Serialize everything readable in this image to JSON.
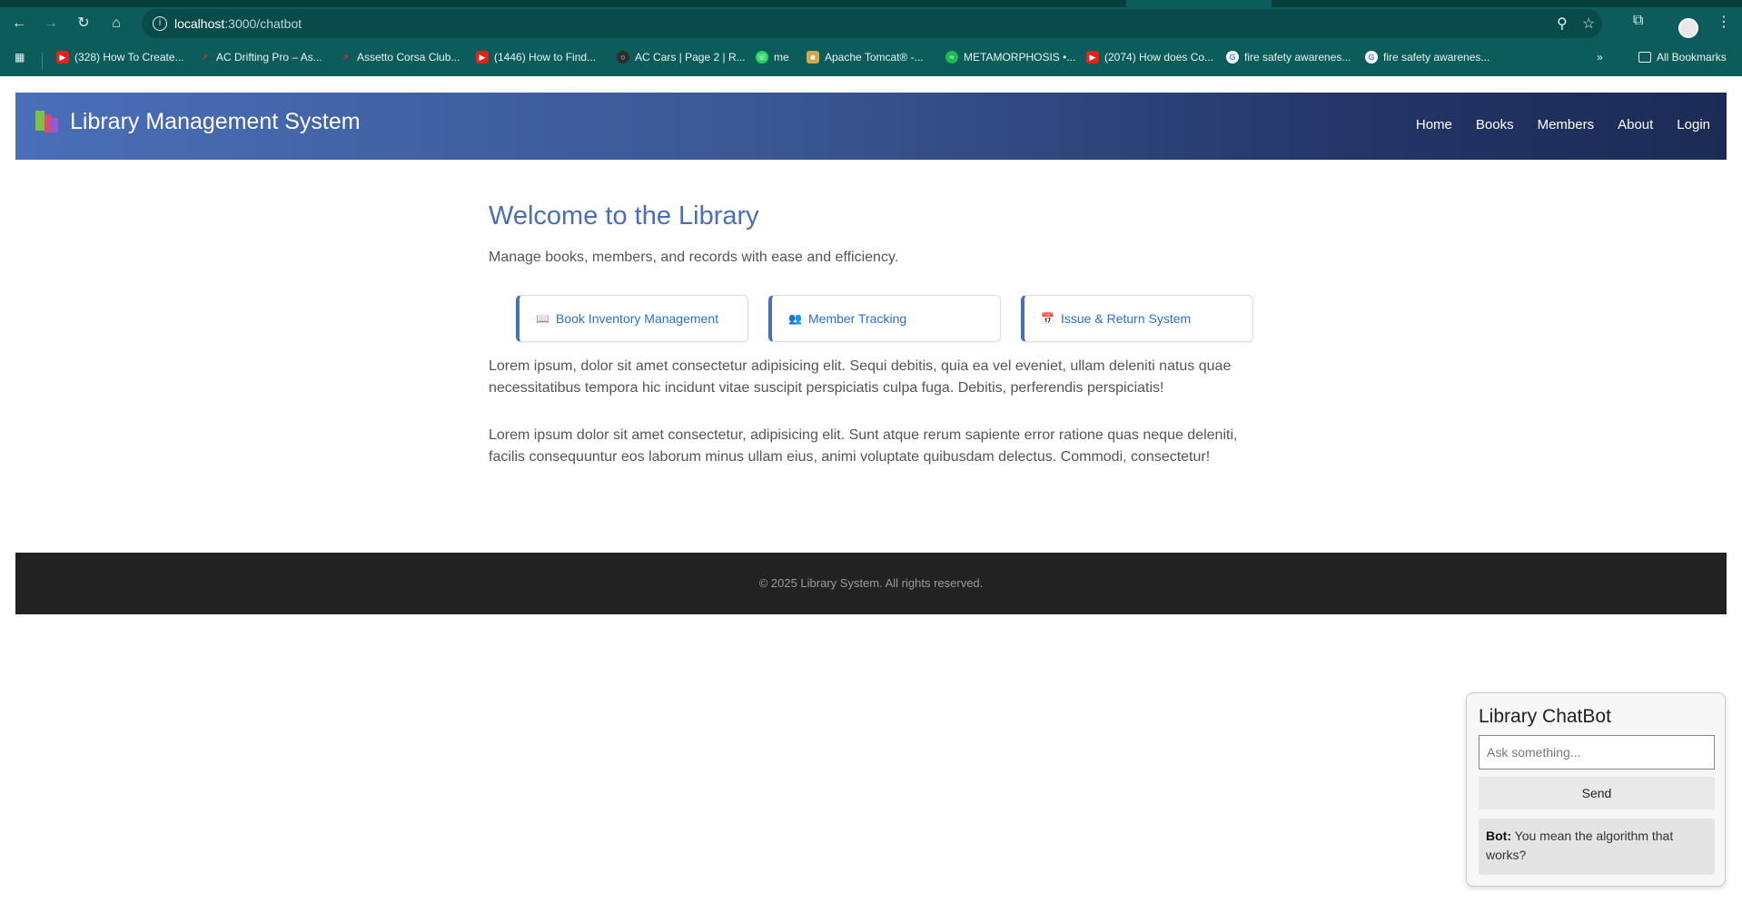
{
  "browser": {
    "url_host": "localhost",
    "url_path": ":3000/chatbot",
    "bookmarks": [
      {
        "icon": "youtube-icon",
        "label": "(328) How To Create..."
      },
      {
        "icon": "ac-drifting-icon",
        "label": "AC Drifting Pro – As..."
      },
      {
        "icon": "assetto-corsa-icon",
        "label": "Assetto Corsa Club..."
      },
      {
        "icon": "youtube-icon",
        "label": "(1446) How to Find..."
      },
      {
        "icon": "race-icon",
        "label": "AC Cars | Page 2 | R..."
      },
      {
        "icon": "whatsapp-icon",
        "label": "me"
      },
      {
        "icon": "tomcat-icon",
        "label": "Apache Tomcat® -..."
      },
      {
        "icon": "spotify-icon",
        "label": "METAMORPHOSIS •..."
      },
      {
        "icon": "youtube-icon",
        "label": "(2074) How does Co..."
      },
      {
        "icon": "google-icon",
        "label": "fire safety awarenes..."
      },
      {
        "icon": "google-icon",
        "label": "fire safety awarenes..."
      }
    ],
    "all_bookmarks": "All Bookmarks"
  },
  "header": {
    "title": "Library Management System",
    "nav": [
      "Home",
      "Books",
      "Members",
      "About",
      "Login"
    ]
  },
  "main": {
    "welcome": "Welcome to the Library",
    "subtitle": "Manage books, members, and records with ease and efficiency.",
    "features": [
      {
        "icon": "📖",
        "label": "Book Inventory Management"
      },
      {
        "icon": "👥",
        "label": "Member Tracking"
      },
      {
        "icon": "📅",
        "label": "Issue & Return System"
      }
    ],
    "paragraph1": "Lorem ipsum, dolor sit amet consectetur adipisicing elit. Sequi debitis, quia ea vel eveniet, ullam deleniti natus quae necessitatibus tempora hic incidunt vitae suscipit perspiciatis culpa fuga. Debitis, perferendis perspiciatis!",
    "paragraph2": "Lorem ipsum dolor sit amet consectetur, adipisicing elit. Sunt atque rerum sapiente error ratione quas neque deleniti, facilis consequuntur eos laborum minus ullam eius, animi voluptate quibusdam delectus. Commodi, consectetur!"
  },
  "footer": {
    "text": "© 2025 Library System. All rights reserved."
  },
  "chatbot": {
    "title": "Library ChatBot",
    "input_placeholder": "Ask something...",
    "send_label": "Send",
    "message_sender": "Bot:",
    "message_text": " You mean the algorithm that works?"
  }
}
